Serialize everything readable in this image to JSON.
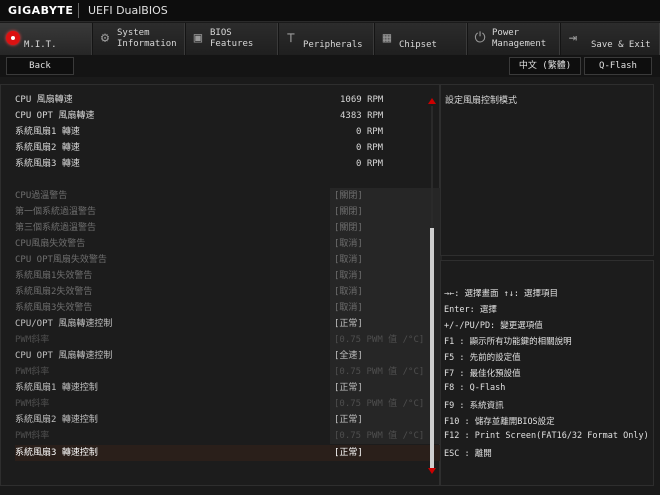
{
  "header": {
    "logo": "GIGABYTE",
    "title": "UEFI DualBIOS"
  },
  "tabs": [
    {
      "label": "M.I.T."
    },
    {
      "label": "System\nInformation"
    },
    {
      "label": "BIOS\nFeatures"
    },
    {
      "label": "Peripherals"
    },
    {
      "label": "Chipset"
    },
    {
      "label": "Power\nManagement"
    },
    {
      "label": "Save & Exit"
    }
  ],
  "toolbar": {
    "back": "Back",
    "language": "中文 (繁體)",
    "qflash": "Q-Flash"
  },
  "fan_speeds": [
    {
      "label": "CPU 風扇轉速",
      "value": "1069 RPM"
    },
    {
      "label": "CPU OPT 風扇轉速",
      "value": "4383 RPM"
    },
    {
      "label": "系統風扇1 轉速",
      "value": "0 RPM"
    },
    {
      "label": "系統風扇2 轉速",
      "value": "0 RPM"
    },
    {
      "label": "系統風扇3 轉速",
      "value": "0 RPM"
    }
  ],
  "settings": [
    {
      "label": "CPU過溫警告",
      "value": "[關閉]"
    },
    {
      "label": "第一個系統過溫警告",
      "value": "[關閉]"
    },
    {
      "label": "第三個系統過溫警告",
      "value": "[關閉]"
    },
    {
      "label": "CPU風扇失效警告",
      "value": "[取消]"
    },
    {
      "label": "CPU OPT風扇失效警告",
      "value": "[取消]"
    },
    {
      "label": "系統風扇1失效警告",
      "value": "[取消]"
    },
    {
      "label": "系統風扇2失效警告",
      "value": "[取消]"
    },
    {
      "label": "系統風扇3失效警告",
      "value": "[取消]"
    },
    {
      "label": "CPU/OPT 風扇轉速控制",
      "value": "[正常]"
    },
    {
      "label": "PWM斜率",
      "value": "[0.75 PWM 值 /°C]"
    },
    {
      "label": "CPU OPT 風扇轉速控制",
      "value": "[全速]"
    },
    {
      "label": "PWM斜率",
      "value": "[0.75 PWM 值 /°C]"
    },
    {
      "label": "系統風扇1 轉速控制",
      "value": "[正常]"
    },
    {
      "label": "PWM斜率",
      "value": "[0.75 PWM 值 /°C]"
    },
    {
      "label": "系統風扇2 轉速控制",
      "value": "[正常]"
    },
    {
      "label": "PWM斜率",
      "value": "[0.75 PWM 值 /°C]"
    },
    {
      "label": "系統風扇3 轉速控制",
      "value": "[正常]"
    }
  ],
  "help_text": "設定風扇控制模式",
  "key_help": [
    "→←: 選擇畫面  ↑↓: 選擇項目",
    "Enter: 選擇",
    "+/-/PU/PD: 變更選項值",
    "F1  : 顯示所有功能鍵的相關說明",
    "F5  : 先前的設定值",
    "F7  : 最佳化預設值",
    "F8  : Q-Flash",
    "F9  : 系統資訊",
    "F10 : 儲存並離開BIOS設定",
    "F12 : Print Screen(FAT16/32 Format Only)",
    "ESC : 離開"
  ]
}
